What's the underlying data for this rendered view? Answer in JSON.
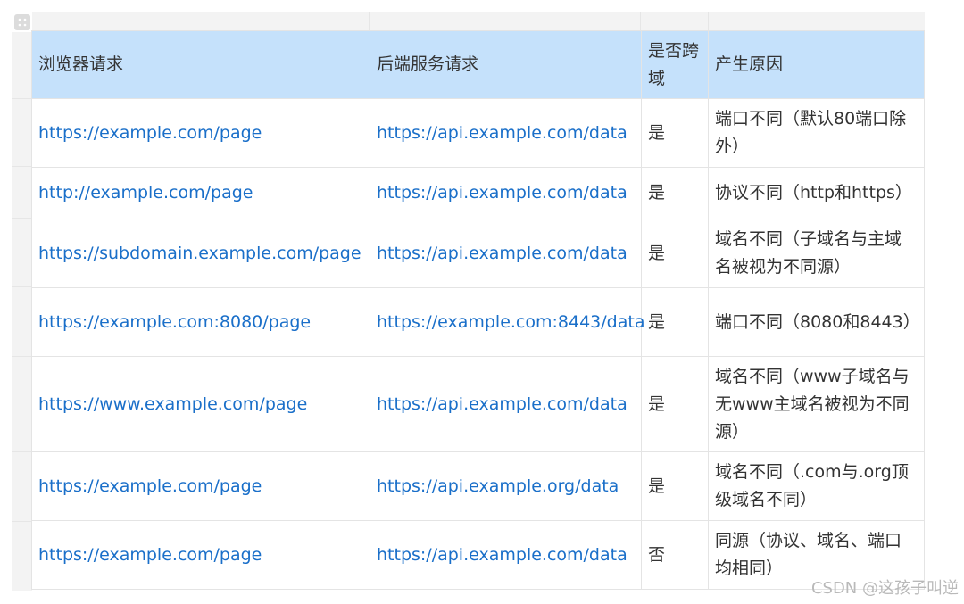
{
  "table": {
    "headers": [
      "浏览器请求",
      "后端服务请求",
      "是否跨域",
      "产生原因"
    ],
    "rows": [
      {
        "browser": "https://example.com/page",
        "backend": "https://api.example.com/data",
        "cross": "是",
        "reason": "端口不同（默认80端口除外）"
      },
      {
        "browser": "http://example.com/page",
        "backend": "https://api.example.com/data",
        "cross": "是",
        "reason": "协议不同（http和https）"
      },
      {
        "browser": "https://subdomain.example.com/page",
        "backend": "https://api.example.com/data",
        "cross": "是",
        "reason": "域名不同（子域名与主域名被视为不同源）"
      },
      {
        "browser": "https://example.com:8080/page",
        "backend": "https://example.com:8443/data",
        "cross": "是",
        "reason": "端口不同（8080和8443）"
      },
      {
        "browser": "https://www.example.com/page",
        "backend": "https://api.example.com/data",
        "cross": "是",
        "reason": "域名不同（www子域名与无www主域名被视为不同源）"
      },
      {
        "browser": "https://example.com/page",
        "backend": "https://api.example.org/data",
        "cross": "是",
        "reason": "域名不同（.com与.org顶级域名不同）"
      },
      {
        "browser": "https://example.com/page",
        "backend": "https://api.example.com/data",
        "cross": "否",
        "reason": "同源（协议、域名、端口均相同）"
      }
    ]
  },
  "watermark": "CSDN @这孩子叫逆",
  "colors": {
    "header_bg": "#c5e1fb",
    "link": "#1a6fc9",
    "border": "#e4e4e4",
    "text": "#333333"
  },
  "icons": {
    "table_handle": "grid-handle-icon"
  }
}
